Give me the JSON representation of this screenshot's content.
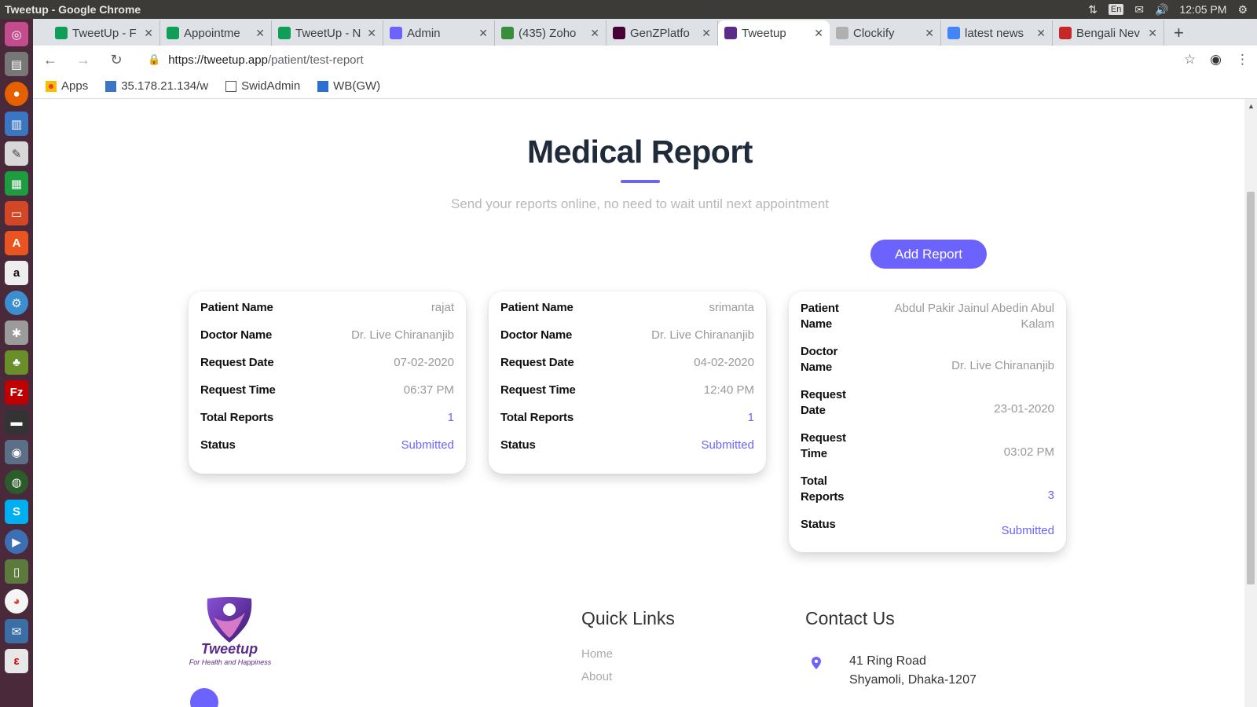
{
  "os": {
    "window_title": "Tweetup - Google Chrome",
    "lang": "En",
    "clock": "12:05 PM"
  },
  "browser": {
    "tabs": [
      {
        "label": "TweetUp - F",
        "icon": "sheets-icon",
        "color": "#0f9d58",
        "active": false
      },
      {
        "label": "Appointme",
        "icon": "sheets-icon",
        "color": "#0f9d58",
        "active": false
      },
      {
        "label": "TweetUp - N",
        "icon": "sheets-icon",
        "color": "#0f9d58",
        "active": false
      },
      {
        "label": "Admin",
        "icon": "tweetup-icon",
        "color": "#6c63ff",
        "active": false
      },
      {
        "label": "(435) Zoho",
        "icon": "zoho-icon",
        "color": "#3a8d3a",
        "active": false
      },
      {
        "label": "GenZPlatfo",
        "icon": "xd-icon",
        "color": "#470137",
        "active": false
      },
      {
        "label": "Tweetup",
        "icon": "tweetup-icon",
        "color": "#5b2b8a",
        "active": true
      },
      {
        "label": "Clockify",
        "icon": "clockify-icon",
        "color": "#b0b0b0",
        "active": false
      },
      {
        "label": "latest news",
        "icon": "google-icon",
        "color": "#4285f4",
        "active": false
      },
      {
        "label": "Bengali Nev",
        "icon": "zee-icon",
        "color": "#c62828",
        "active": false
      }
    ],
    "url_host": "https://tweetup.app",
    "url_path": "/patient/test-report",
    "bookmarks": [
      {
        "label": "Apps",
        "icon": "apps-grid-icon"
      },
      {
        "label": "35.178.21.134/w",
        "icon": "site-icon"
      },
      {
        "label": "SwidAdmin",
        "icon": "page-icon"
      },
      {
        "label": "WB(GW)",
        "icon": "wb-icon"
      }
    ]
  },
  "page": {
    "title": "Medical Report",
    "subtitle": "Send your reports online, no need to wait until next appointment",
    "add_button": "Add Report",
    "labels": {
      "patient_name": "Patient Name",
      "doctor_name": "Doctor Name",
      "request_date": "Request Date",
      "request_time": "Request Time",
      "total_reports": "Total Reports",
      "status": "Status"
    },
    "reports": [
      {
        "patient": "rajat",
        "doctor": "Dr. Live Chirananjib",
        "date": "07-02-2020",
        "time": "06:37 PM",
        "total": "1",
        "status": "Submitted"
      },
      {
        "patient": "srimanta",
        "doctor": "Dr. Live Chirananjib",
        "date": "04-02-2020",
        "time": "12:40 PM",
        "total": "1",
        "status": "Submitted"
      },
      {
        "patient": "Abdul Pakir Jainul Abedin Abul Kalam",
        "doctor": "Dr. Live Chirananjib",
        "date": "23-01-2020",
        "time": "03:02 PM",
        "total": "3",
        "status": "Submitted"
      }
    ],
    "accent": "#6c63ff"
  },
  "footer": {
    "logo_text": "Tweetup",
    "tagline": "For Health and Happiness",
    "quick_links_title": "Quick Links",
    "quick_links": [
      "Home",
      "About"
    ],
    "contact_title": "Contact Us",
    "address_line1": "41 Ring Road",
    "address_line2": "Shyamoli, Dhaka-1207"
  }
}
